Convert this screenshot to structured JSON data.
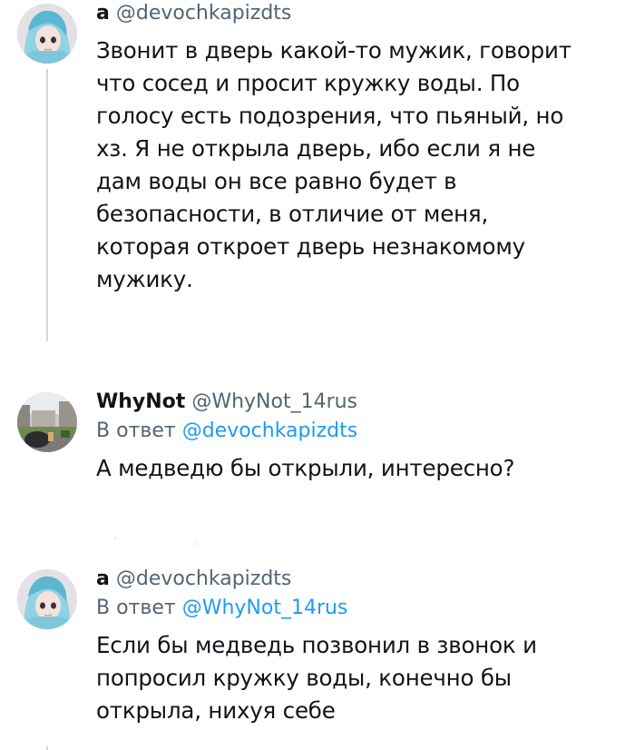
{
  "tweets": [
    {
      "author_name": "a",
      "author_handle": "@devochkapizdts",
      "reply_prefix": "",
      "reply_handle": "",
      "lines": [
        "Звонит в дверь какой-то мужик, говорит",
        "что сосед и просит кружку воды. По",
        "голосу есть подозрения, что пьяный, но",
        "хз. Я не открыла дверь, ибо если я не",
        "дам воды он все равно будет в",
        "безопасности, в отличие от меня,",
        "которая откроет дверь незнакомому",
        "мужику."
      ]
    },
    {
      "author_name": "WhyNot",
      "author_handle": "@WhyNot_14rus",
      "reply_prefix": "В ответ",
      "reply_handle": "@devochkapizdts",
      "lines": [
        "А медведю бы открыли, интересно?"
      ]
    },
    {
      "author_name": "a",
      "author_handle": "@devochkapizdts",
      "reply_prefix": "В ответ",
      "reply_handle": "@WhyNot_14rus",
      "lines": [
        "Если бы медведь позвонил в звонок и",
        "попросил кружку воды, конечно бы",
        "открыла, нихуя себе"
      ]
    }
  ],
  "colors": {
    "text": "#0f1419",
    "secondary": "#536471",
    "link": "#1d9bf0",
    "thread_line": "#cfd9de"
  }
}
